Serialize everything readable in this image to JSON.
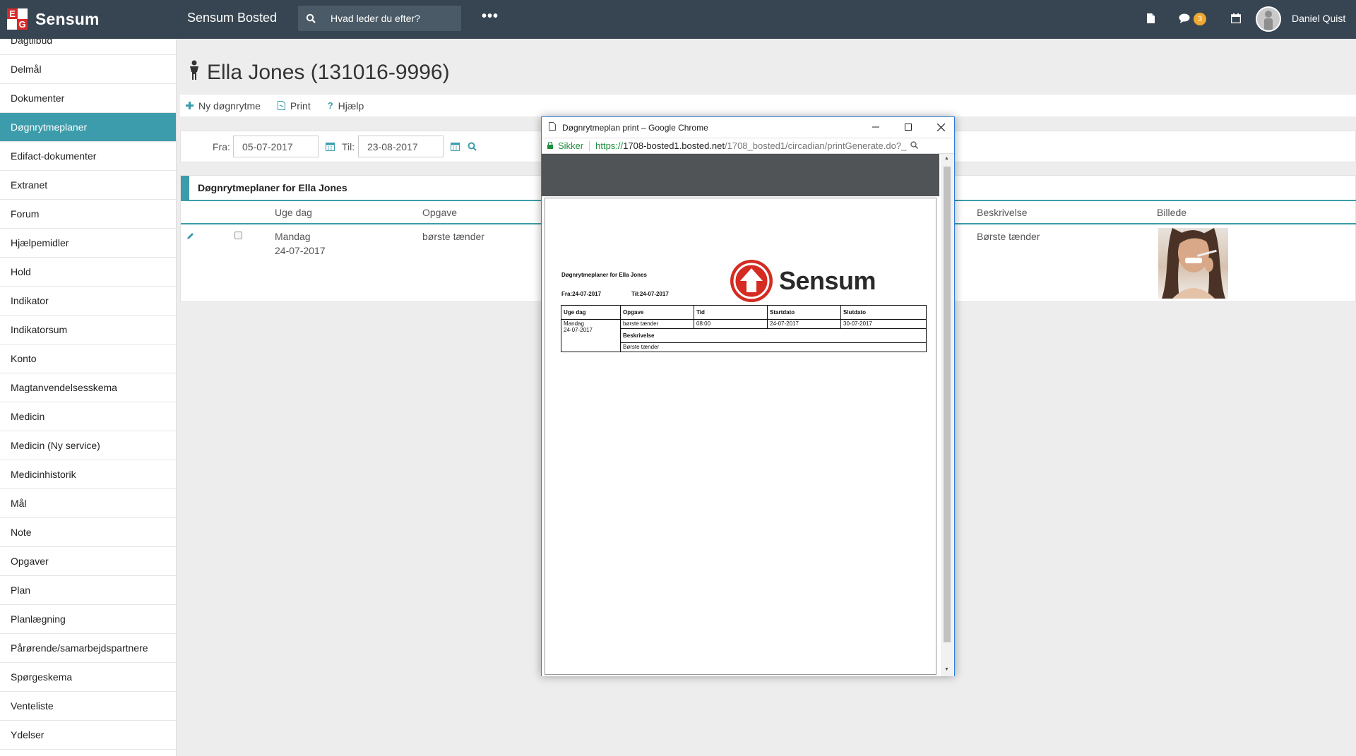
{
  "topbar": {
    "brand_letters": {
      "e": "E",
      "g": "G"
    },
    "brand": "Sensum",
    "app_title": "Sensum Bosted",
    "search_placeholder": "Hvad leder du efter?",
    "more": "•••",
    "messages_count": "3",
    "user_name": "Daniel Quist",
    "icons": [
      "search-icon",
      "document-icon",
      "chat-icon",
      "calendar-icon",
      "avatar"
    ]
  },
  "sidebar": {
    "items": [
      {
        "label": "Dagtilbud"
      },
      {
        "label": "Delmål"
      },
      {
        "label": "Dokumenter"
      },
      {
        "label": "Døgnrytmeplaner"
      },
      {
        "label": "Edifact-dokumenter"
      },
      {
        "label": "Extranet"
      },
      {
        "label": "Forum"
      },
      {
        "label": "Hjælpemidler"
      },
      {
        "label": "Hold"
      },
      {
        "label": "Indikator"
      },
      {
        "label": "Indikatorsum"
      },
      {
        "label": "Konto"
      },
      {
        "label": "Magtanvendelsesskema"
      },
      {
        "label": "Medicin"
      },
      {
        "label": "Medicin (Ny service)"
      },
      {
        "label": "Medicinhistorik"
      },
      {
        "label": "Mål"
      },
      {
        "label": "Note"
      },
      {
        "label": "Opgaver"
      },
      {
        "label": "Plan"
      },
      {
        "label": "Planlægning"
      },
      {
        "label": "Pårørende/samarbejdspartnere"
      },
      {
        "label": "Spørgeskema"
      },
      {
        "label": "Venteliste"
      },
      {
        "label": "Ydelser"
      }
    ],
    "active_index": 3
  },
  "main": {
    "title": "Ella Jones (131016-9996)",
    "actions": {
      "new": "Ny døgnrytme",
      "print": "Print",
      "help": "Hjælp"
    },
    "filter": {
      "from_label": "Fra:",
      "from_value": "05-07-2017",
      "to_label": "Til:",
      "to_value": "23-08-2017"
    },
    "panel": {
      "title": "Døgnrytmeplaner for  Ella Jones",
      "columns": {
        "weekday": "Uge dag",
        "task": "Opgave",
        "description": "Beskrivelse",
        "image": "Billede"
      },
      "row": {
        "weekday": "Mandag",
        "date": "24-07-2017",
        "task": "børste tænder",
        "description": "Børste tænder"
      }
    }
  },
  "popup": {
    "window_title": "Døgnrytmeplan print – Google Chrome",
    "secure_label": "Sikker",
    "url_scheme": "https://",
    "url_host": "1708-bosted1.bosted.net",
    "url_path": "/1708_bosted1/circadian/printGenerate.do?_",
    "doc": {
      "title": "Døgnrytmeplaner for Ella Jones",
      "from": "Fra:24-07-2017",
      "to": "Til:24-07-2017",
      "logo_text": "Sensum",
      "headers": [
        "Uge dag",
        "Opgave",
        "Tid",
        "Startdato",
        "Slutdato"
      ],
      "row": {
        "weekday": "Mandag",
        "date": "24-07-2017",
        "task": "børste tænder",
        "time": "08:00",
        "start": "24-07-2017",
        "end": "30-07-2017"
      },
      "description_label": "Beskrivelse",
      "description": "Børste tænder"
    }
  }
}
